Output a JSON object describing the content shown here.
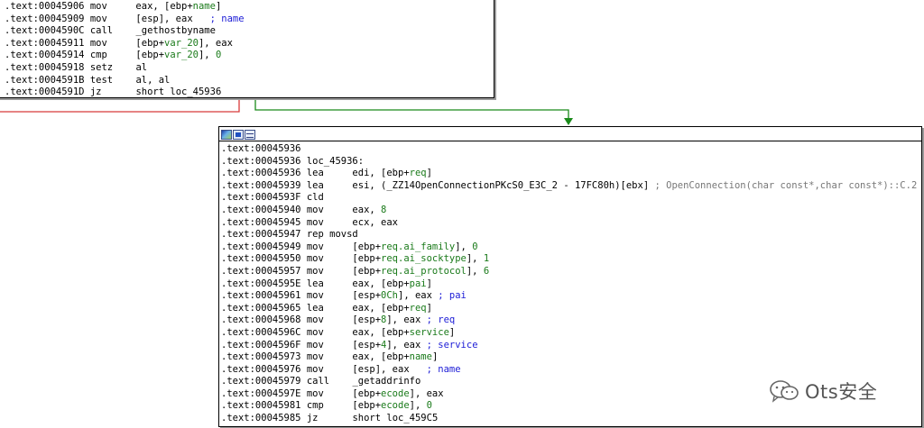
{
  "top_block": {
    "lines": [
      {
        "addr": ".text:00045906",
        "mnem": "mov",
        "ops": [
          {
            "t": "eax, [ebp+",
            "c": "opn"
          },
          {
            "t": "name",
            "c": "var"
          },
          {
            "t": "]",
            "c": "opn"
          }
        ],
        "comment": ""
      },
      {
        "addr": ".text:00045909",
        "mnem": "mov",
        "ops": [
          {
            "t": "[esp], eax",
            "c": "opn"
          }
        ],
        "comment": "; name"
      },
      {
        "addr": ".text:0004590C",
        "mnem": "call",
        "ops": [
          {
            "t": "_gethostbyname",
            "c": "opn"
          }
        ],
        "comment": ""
      },
      {
        "addr": ".text:00045911",
        "mnem": "mov",
        "ops": [
          {
            "t": "[ebp+",
            "c": "opn"
          },
          {
            "t": "var_20",
            "c": "var"
          },
          {
            "t": "], eax",
            "c": "opn"
          }
        ],
        "comment": ""
      },
      {
        "addr": ".text:00045914",
        "mnem": "cmp",
        "ops": [
          {
            "t": "[ebp+",
            "c": "opn"
          },
          {
            "t": "var_20",
            "c": "var"
          },
          {
            "t": "], ",
            "c": "opn"
          },
          {
            "t": "0",
            "c": "num"
          }
        ],
        "comment": ""
      },
      {
        "addr": ".text:00045918",
        "mnem": "setz",
        "ops": [
          {
            "t": "al",
            "c": "opn"
          }
        ],
        "comment": ""
      },
      {
        "addr": ".text:0004591B",
        "mnem": "test",
        "ops": [
          {
            "t": "al, al",
            "c": "opn"
          }
        ],
        "comment": ""
      },
      {
        "addr": ".text:0004591D",
        "mnem": "jz",
        "ops": [
          {
            "t": "short loc_45936",
            "c": "opn"
          }
        ],
        "comment": ""
      }
    ]
  },
  "bottom_block": {
    "toolbar_icons": [
      "graph-color-icon",
      "edit-node-icon",
      "group-nodes-icon"
    ],
    "lines": [
      {
        "addr": ".text:00045936",
        "mnem": "",
        "ops": [],
        "comment": ""
      },
      {
        "addr": ".text:00045936",
        "mnem": "loc_45936:",
        "ops": [],
        "comment": ""
      },
      {
        "addr": ".text:00045936",
        "mnem": "lea",
        "ops": [
          {
            "t": "edi, [ebp+",
            "c": "opn"
          },
          {
            "t": "req",
            "c": "var"
          },
          {
            "t": "]",
            "c": "opn"
          }
        ],
        "comment": ""
      },
      {
        "addr": ".text:00045939",
        "mnem": "lea",
        "ops": [
          {
            "t": "esi, (_ZZ14OpenConnectionPKcS0_E3C_2 - 17FC80h)[ebx]",
            "c": "opn"
          }
        ],
        "comment": "; OpenConnection(char const*,char const*)::C.2",
        "comment_class": "cmt-gray"
      },
      {
        "addr": ".text:0004593F",
        "mnem": "cld",
        "ops": [],
        "comment": ""
      },
      {
        "addr": ".text:00045940",
        "mnem": "mov",
        "ops": [
          {
            "t": "eax, ",
            "c": "opn"
          },
          {
            "t": "8",
            "c": "num"
          }
        ],
        "comment": ""
      },
      {
        "addr": ".text:00045945",
        "mnem": "mov",
        "ops": [
          {
            "t": "ecx, eax",
            "c": "opn"
          }
        ],
        "comment": ""
      },
      {
        "addr": ".text:00045947",
        "mnem": "rep movsd",
        "ops": [],
        "comment": ""
      },
      {
        "addr": ".text:00045949",
        "mnem": "mov",
        "ops": [
          {
            "t": "[ebp+",
            "c": "opn"
          },
          {
            "t": "req.ai_family",
            "c": "var"
          },
          {
            "t": "], ",
            "c": "opn"
          },
          {
            "t": "0",
            "c": "num"
          }
        ],
        "comment": ""
      },
      {
        "addr": ".text:00045950",
        "mnem": "mov",
        "ops": [
          {
            "t": "[ebp+",
            "c": "opn"
          },
          {
            "t": "req.ai_socktype",
            "c": "var"
          },
          {
            "t": "], ",
            "c": "opn"
          },
          {
            "t": "1",
            "c": "num"
          }
        ],
        "comment": ""
      },
      {
        "addr": ".text:00045957",
        "mnem": "mov",
        "ops": [
          {
            "t": "[ebp+",
            "c": "opn"
          },
          {
            "t": "req.ai_protocol",
            "c": "var"
          },
          {
            "t": "], ",
            "c": "opn"
          },
          {
            "t": "6",
            "c": "num"
          }
        ],
        "comment": ""
      },
      {
        "addr": ".text:0004595E",
        "mnem": "lea",
        "ops": [
          {
            "t": "eax, [ebp+",
            "c": "opn"
          },
          {
            "t": "pai",
            "c": "var"
          },
          {
            "t": "]",
            "c": "opn"
          }
        ],
        "comment": ""
      },
      {
        "addr": ".text:00045961",
        "mnem": "mov",
        "ops": [
          {
            "t": "[esp+",
            "c": "opn"
          },
          {
            "t": "0Ch",
            "c": "num"
          },
          {
            "t": "], eax",
            "c": "opn"
          }
        ],
        "comment": "; pai"
      },
      {
        "addr": ".text:00045965",
        "mnem": "lea",
        "ops": [
          {
            "t": "eax, [ebp+",
            "c": "opn"
          },
          {
            "t": "req",
            "c": "var"
          },
          {
            "t": "]",
            "c": "opn"
          }
        ],
        "comment": ""
      },
      {
        "addr": ".text:00045968",
        "mnem": "mov",
        "ops": [
          {
            "t": "[esp+",
            "c": "opn"
          },
          {
            "t": "8",
            "c": "num"
          },
          {
            "t": "], eax",
            "c": "opn"
          }
        ],
        "comment": "; req"
      },
      {
        "addr": ".text:0004596C",
        "mnem": "mov",
        "ops": [
          {
            "t": "eax, [ebp+",
            "c": "opn"
          },
          {
            "t": "service",
            "c": "var"
          },
          {
            "t": "]",
            "c": "opn"
          }
        ],
        "comment": ""
      },
      {
        "addr": ".text:0004596F",
        "mnem": "mov",
        "ops": [
          {
            "t": "[esp+",
            "c": "opn"
          },
          {
            "t": "4",
            "c": "num"
          },
          {
            "t": "], eax",
            "c": "opn"
          }
        ],
        "comment": "; service"
      },
      {
        "addr": ".text:00045973",
        "mnem": "mov",
        "ops": [
          {
            "t": "eax, [ebp+",
            "c": "opn"
          },
          {
            "t": "name",
            "c": "var"
          },
          {
            "t": "]",
            "c": "opn"
          }
        ],
        "comment": ""
      },
      {
        "addr": ".text:00045976",
        "mnem": "mov",
        "ops": [
          {
            "t": "[esp], eax",
            "c": "opn"
          }
        ],
        "comment": "; name"
      },
      {
        "addr": ".text:00045979",
        "mnem": "call",
        "ops": [
          {
            "t": "_getaddrinfo",
            "c": "opn"
          }
        ],
        "comment": ""
      },
      {
        "addr": ".text:0004597E",
        "mnem": "mov",
        "ops": [
          {
            "t": "[ebp+",
            "c": "opn"
          },
          {
            "t": "ecode",
            "c": "var"
          },
          {
            "t": "], eax",
            "c": "opn"
          }
        ],
        "comment": ""
      },
      {
        "addr": ".text:00045981",
        "mnem": "cmp",
        "ops": [
          {
            "t": "[ebp+",
            "c": "opn"
          },
          {
            "t": "ecode",
            "c": "var"
          },
          {
            "t": "], ",
            "c": "opn"
          },
          {
            "t": "0",
            "c": "num"
          }
        ],
        "comment": ""
      },
      {
        "addr": ".text:00045985",
        "mnem": "jz",
        "ops": [
          {
            "t": "short loc_459C5",
            "c": "opn"
          }
        ],
        "comment": ""
      }
    ]
  },
  "edges": {
    "true_color": "#1a8a1a",
    "false_color": "#d83a3a"
  },
  "watermark": {
    "text": "Ots安全",
    "icon": "wechat-logo-icon"
  }
}
